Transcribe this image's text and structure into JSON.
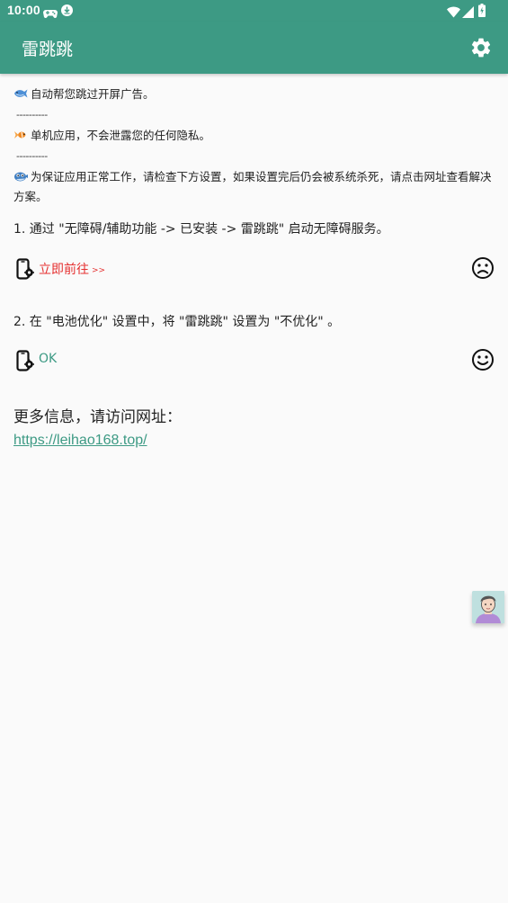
{
  "status_bar": {
    "time": "10:00",
    "icons": [
      "gamepad-icon",
      "download-icon",
      "wifi-icon",
      "signal-icon",
      "battery-icon"
    ]
  },
  "app_bar": {
    "title": "雷跳跳",
    "settings_icon": "gear-icon",
    "background_color": "#3d9a84"
  },
  "notes": [
    {
      "icon": "fish-icon",
      "text": "自动帮您跳过开屏广告。"
    },
    {
      "separator": "----------"
    },
    {
      "icon": "goldfish-icon",
      "text": "单机应用，不会泄露您的任何隐私。"
    },
    {
      "separator": "----------"
    },
    {
      "icon": "pufferfish-icon",
      "text": "为保证应用正常工作，请检查下方设置，如果设置完后仍会被系统杀死，请点击网址查看解决方案。"
    }
  ],
  "steps": [
    {
      "title": "1. 通过 \"无障碍/辅助功能 -> 已安装 -> 雷跳跳\" 启动无障碍服务。",
      "action_label": "立即前往",
      "action_arrows": ">>",
      "status_icon": "sad-face-icon",
      "status_color": "#e53030"
    },
    {
      "title": "2. 在 \"电池优化\" 设置中，将 \"雷跳跳\" 设置为 \"不优化\" 。",
      "action_label": "OK",
      "status_icon": "smiley-face-icon",
      "status_color": "#3d9a84"
    }
  ],
  "more_info": {
    "label": "更多信息，请访问网址：",
    "url": "https://leihao168.top/"
  },
  "floating_avatar": {
    "icon": "cartoon-man-avatar"
  }
}
